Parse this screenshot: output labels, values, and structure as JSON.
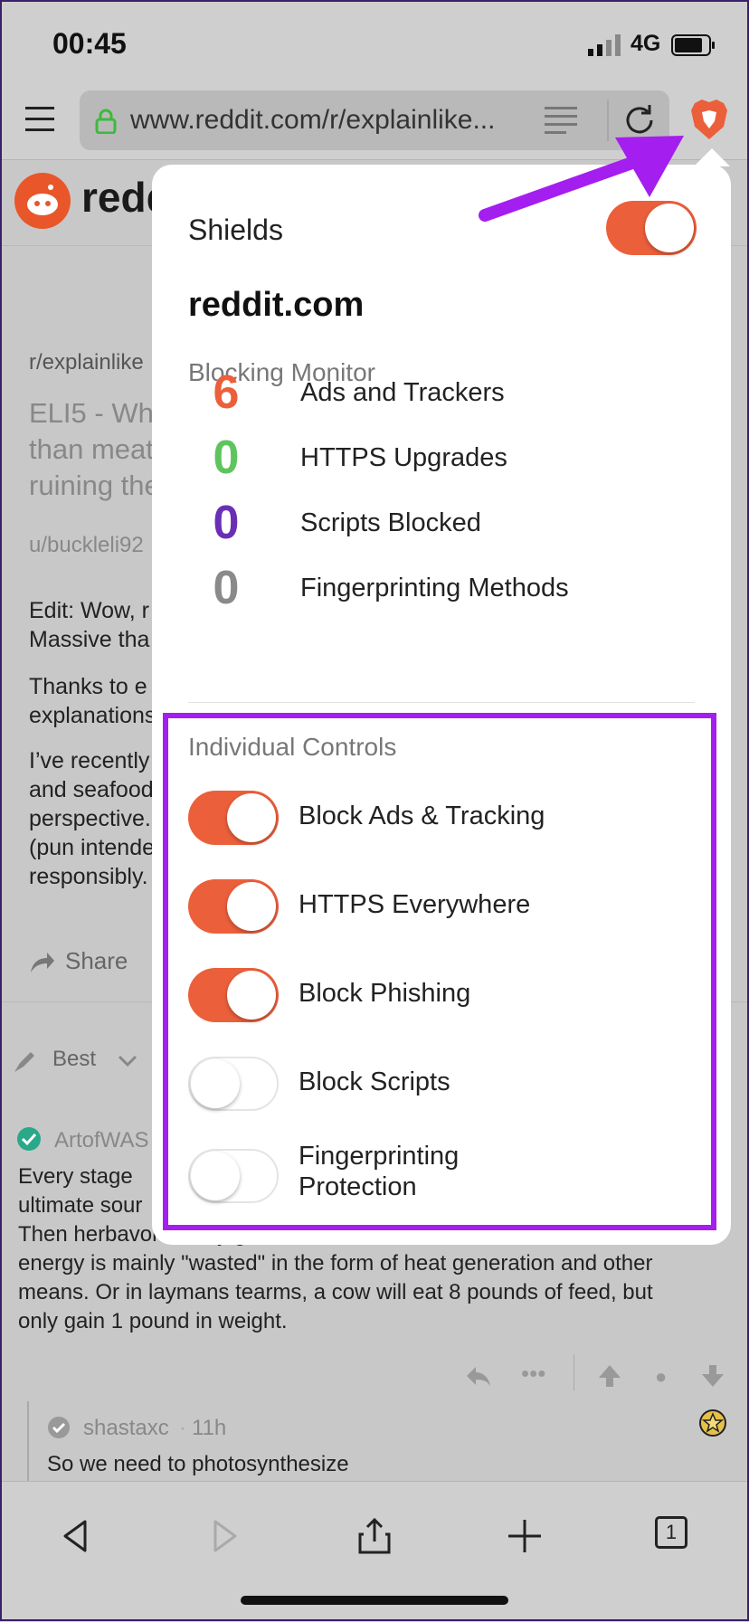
{
  "status_bar": {
    "time": "00:45",
    "network": "4G"
  },
  "toolbar": {
    "url": "www.reddit.com/r/explainlike..."
  },
  "page": {
    "logo_text": "redd",
    "subreddit": "r/explainlike",
    "title_lines": [
      "ELI5 - Wh",
      "than meat",
      "ruining the"
    ],
    "author": "u/buckleli92",
    "edit_lines": [
      "Edit: Wow, r",
      "Massive tha"
    ],
    "thanks_lines": [
      "Thanks to e",
      "explanations"
    ],
    "recent_lines": [
      "I’ve recently",
      "and seafood",
      "perspective.",
      "(pun intende",
      "responsibly."
    ],
    "share": "Share",
    "sort": "Best",
    "comment_author": "ArtofWAS",
    "comment_lines": [
      "Every stage",
      "ultimate sour",
      "Then herbavores only get 10% of that 10% and the rest of the",
      "energy is mainly \"wasted\" in the form of heat generation and other",
      "means. Or in laymans tearms, a cow will eat 8 pounds of feed, but",
      "only gain 1 pound in weight."
    ],
    "reply_author": "shastaxc",
    "reply_time": "11h",
    "reply_text": "So we need to photosynthesize"
  },
  "shields": {
    "label": "Shields",
    "enabled": true,
    "domain": "reddit.com",
    "monitor_title": "Blocking Monitor",
    "stats": [
      {
        "value": "6",
        "label": "Ads and Trackers",
        "color": "#ec5f3b"
      },
      {
        "value": "0",
        "label": "HTTPS Upgrades",
        "color": "#5ec55e"
      },
      {
        "value": "0",
        "label": "Scripts Blocked",
        "color": "#6a2fb4"
      },
      {
        "value": "0",
        "label": "Fingerprinting Methods",
        "color": "#8a8a8a"
      }
    ],
    "controls_title": "Individual Controls",
    "controls": [
      {
        "label": "Block Ads & Tracking",
        "on": true
      },
      {
        "label": "HTTPS Everywhere",
        "on": true
      },
      {
        "label": "Block Phishing",
        "on": true
      },
      {
        "label": "Block Scripts",
        "on": false
      },
      {
        "label": "Fingerprinting",
        "label2": "Protection",
        "on": false
      }
    ]
  },
  "colors": {
    "accent": "#ec5f3b",
    "highlight": "#a41ef0"
  }
}
